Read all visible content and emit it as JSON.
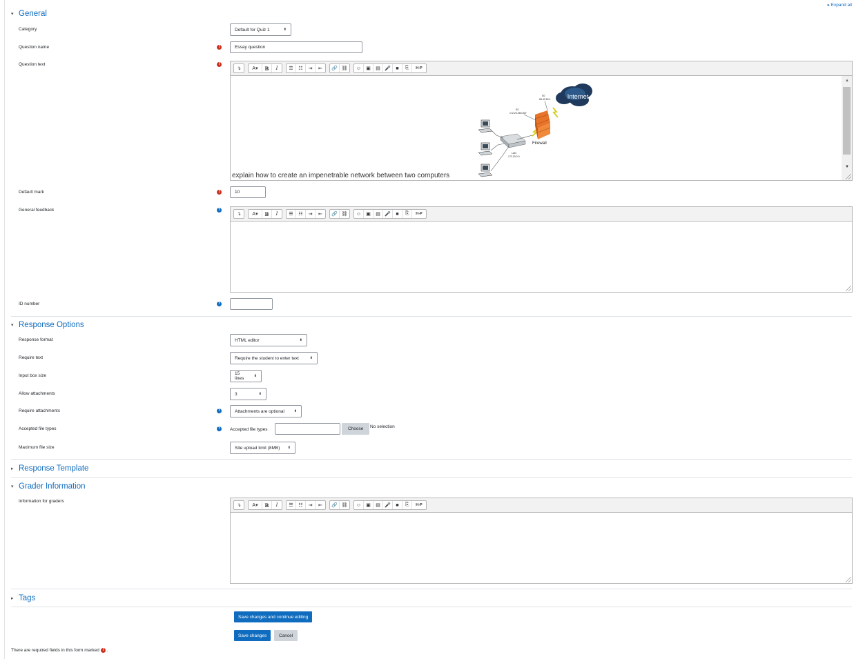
{
  "header": {
    "expand_all": "Expand all"
  },
  "sections": {
    "general": "General",
    "response_options": "Response Options",
    "response_template": "Response Template",
    "grader_information": "Grader Information",
    "tags": "Tags"
  },
  "general": {
    "category_label": "Category",
    "category_value": "Default for Quiz 1",
    "question_name_label": "Question name",
    "question_name_value": "Essay question",
    "question_text_label": "Question text",
    "question_text_value": "explain how to create an impenetrable network between two computers",
    "diagram": {
      "cloud": "Internet",
      "firewall": "Firewall",
      "s0_label": "S0",
      "s0_ip": "65.43.18.1",
      "e0_label": "E0",
      "e0_ip": "172.20.250.200",
      "lan_label": "LAN",
      "lan_ip": "172.20.0.0"
    },
    "default_mark_label": "Default mark",
    "default_mark_value": "10",
    "general_feedback_label": "General feedback",
    "id_number_label": "ID number",
    "id_number_value": ""
  },
  "toolbar": {
    "buttons": [
      "↴",
      "A▾",
      "B",
      "I",
      "☰",
      "☷",
      "⇥",
      "⇤",
      "🔗",
      "⛓",
      "☺",
      "▣",
      "▤",
      "🎤",
      "■",
      "⎘",
      "H-P"
    ]
  },
  "response_options": {
    "response_format_label": "Response format",
    "response_format_value": "HTML editor",
    "require_text_label": "Require text",
    "require_text_value": "Require the student to enter text",
    "input_box_size_label": "Input box size",
    "input_box_size_value": "15 lines",
    "allow_attachments_label": "Allow attachments",
    "allow_attachments_value": "3",
    "require_attachments_label": "Require attachments",
    "require_attachments_value": "Attachments are optional",
    "accepted_file_types_label": "Accepted file types",
    "accepted_file_types_inline": "Accepted file types",
    "choose_button": "Choose",
    "no_selection": "No selection",
    "max_file_size_label": "Maximum file size",
    "max_file_size_value": "Site upload limit (8MB)"
  },
  "grader": {
    "info_label": "Information for graders"
  },
  "buttons": {
    "save_continue": "Save changes and continue editing",
    "save": "Save changes",
    "cancel": "Cancel"
  },
  "footer": {
    "required_note": "There are required fields in this form marked",
    "required_note_end": "."
  },
  "colors": {
    "accent": "#0f6cbf",
    "required": "#ca3120"
  }
}
